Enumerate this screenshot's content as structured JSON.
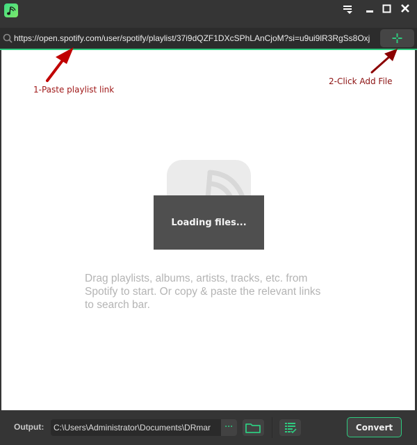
{
  "window": {
    "icons": {
      "logo": "music-note-wave-logo",
      "menu": "menu-icon",
      "minimize": "minimize-icon",
      "maximize": "maximize-icon",
      "close": "close-icon"
    }
  },
  "search": {
    "url": "https://open.spotify.com/user/spotify/playlist/37i9dQZF1DXcSPhLAnCjoM?si=u9ui9lR3RgSs8Oxj",
    "add_button_icon": "plus-icon"
  },
  "annotations": {
    "step1": "1-Paste playlist link",
    "step2": "2-Click Add File"
  },
  "main": {
    "loading_text": "Loading files...",
    "hint_text": "Drag playlists, albums, artists, tracks, etc. from Spotify to start. Or copy & paste the relevant links to search bar."
  },
  "footer": {
    "output_label": "Output:",
    "output_path": "C:\\Users\\Administrator\\Documents\\DRmar",
    "browse_label": "···",
    "convert_label": "Convert"
  },
  "colors": {
    "accent": "#2ecc80",
    "annotation1": "#c00000",
    "annotation2": "#8b0000"
  }
}
